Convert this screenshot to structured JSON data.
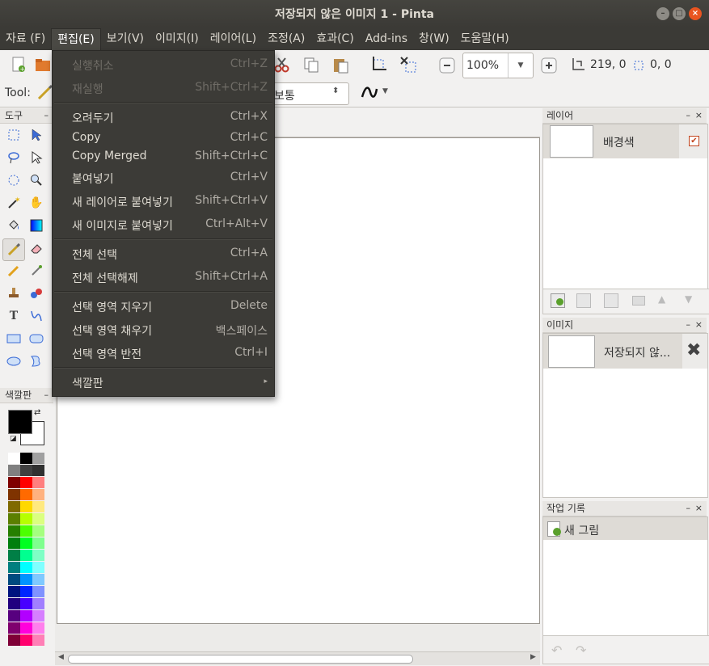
{
  "window": {
    "title": "저장되지 않은 이미지 1 - Pinta"
  },
  "menubar": [
    "자료 (F)",
    "편집(E)",
    "보기(V)",
    "이미지(I)",
    "레이어(L)",
    "조정(A)",
    "효과(C)",
    "Add-ins",
    "창(W)",
    "도움말(H)"
  ],
  "toolbar": {
    "zoom_value": "100%",
    "cursor_pos": "219, 0",
    "selection_size": "0, 0",
    "tool_label": "Tool:",
    "blend_mode": "보통"
  },
  "edit_menu": {
    "items": [
      {
        "label": "실행취소",
        "shortcut": "Ctrl+Z",
        "disabled": true
      },
      {
        "label": "재실행",
        "shortcut": "Shift+Ctrl+Z",
        "disabled": true
      },
      {
        "label": "오려두기",
        "shortcut": "Ctrl+X"
      },
      {
        "label": "Copy",
        "shortcut": "Ctrl+C"
      },
      {
        "label": "Copy Merged",
        "shortcut": "Shift+Ctrl+C"
      },
      {
        "label": "붙여넣기",
        "shortcut": "Ctrl+V"
      },
      {
        "label": "새 레이어로 붙여넣기",
        "shortcut": "Shift+Ctrl+V"
      },
      {
        "label": "새 이미지로 붙여넣기",
        "shortcut": "Ctrl+Alt+V"
      },
      {
        "label": "전체 선택",
        "shortcut": "Ctrl+A"
      },
      {
        "label": "전체 선택해제",
        "shortcut": "Shift+Ctrl+A"
      },
      {
        "label": "선택 영역 지우기",
        "shortcut": "Delete"
      },
      {
        "label": "선택 영역 채우기",
        "shortcut": "백스페이스"
      },
      {
        "label": "선택 영역 반전",
        "shortcut": "Ctrl+I"
      },
      {
        "label": "색깔판",
        "shortcut": "▸"
      }
    ]
  },
  "panels": {
    "tools_title": "도구",
    "palette_title": "색깔판",
    "layers_title": "레이어",
    "layer_name": "배경색",
    "images_title": "이미지",
    "image_name": "저장되지 않...",
    "history_title": "작업 기록",
    "history_item": "새 그림"
  },
  "palette_colors": [
    [
      "#ffffff",
      "#000000"
    ],
    [
      "#a0a0a0",
      "#808080"
    ],
    [
      "#404040",
      "#303030"
    ],
    [
      "#7f0000",
      "#ff0000"
    ],
    [
      "#ff7f7f",
      "#7f3300"
    ],
    [
      "#ff6a00",
      "#ffb27f"
    ],
    [
      "#7f6a00",
      "#ffd800"
    ],
    [
      "#ffe97f",
      "#5b7f00"
    ],
    [
      "#b6ff00",
      "#dbff7f"
    ],
    [
      "#267f00",
      "#4cff00"
    ],
    [
      "#a5ff7f",
      "#007f0e"
    ],
    [
      "#00ff21",
      "#7fff8e"
    ],
    [
      "#007f46",
      "#00ff90"
    ],
    [
      "#7fffc5",
      "#007f7f"
    ],
    [
      "#00ffff",
      "#7fffff"
    ],
    [
      "#004a7f",
      "#0094ff"
    ],
    [
      "#7fc9ff",
      "#00137f"
    ],
    [
      "#0026ff",
      "#7f92ff"
    ],
    [
      "#21007f",
      "#4800ff"
    ],
    [
      "#a17fff",
      "#57007f"
    ],
    [
      "#b200ff",
      "#d67fff"
    ],
    [
      "#7f006e",
      "#ff00dc"
    ],
    [
      "#ff7fed",
      "#7f0037"
    ],
    [
      "#ff006e",
      "#ff7fb6"
    ]
  ]
}
